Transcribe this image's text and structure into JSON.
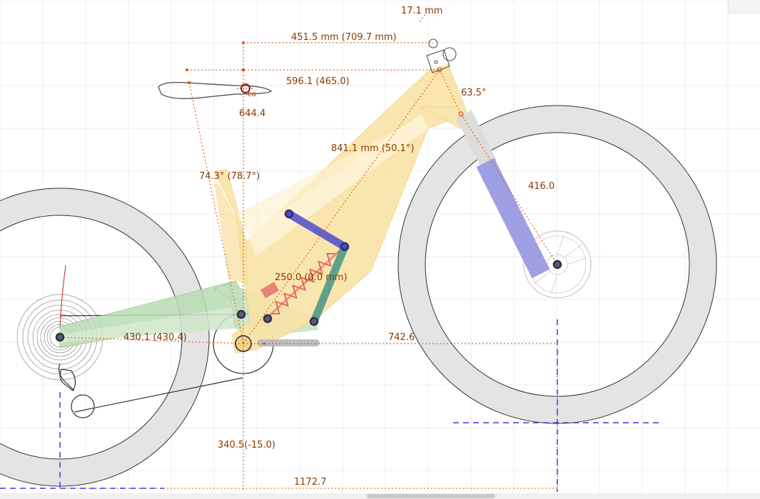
{
  "dimensions": {
    "stem_offset": "17.1 mm",
    "reach_stack": "451.5 mm (709.7 mm)",
    "saddle_to_bar": "596.1 (465.0)",
    "saddle_height": "644.4",
    "head_angle": "63.5°",
    "top_length": "841.1 mm (50.1°)",
    "seat_angle": "74.3° (78.7°)",
    "fork_length": "416.0",
    "shock_length": "250.0 (0.0 mm)",
    "chainstay": "430.1 (430.4)",
    "front_center": "742.6",
    "bb_height": "340.5(-15.0)",
    "wheelbase": "1172.7",
    "cg_label": "CG"
  },
  "colors": {
    "front_triangle": "#f9e3a6",
    "rear_triangle": "#b9dcb5",
    "rocker_link": "#5555cc",
    "seatstay_link": "#4e9a88",
    "fork_lower": "#9a9ae4",
    "fork_upper": "#dcdcdc",
    "shock_spring": "#e06060",
    "tire": "#e4e4e4",
    "dimension_line": "#e04a00",
    "ground_guide": "#3a3ae8"
  },
  "view": {
    "scrollbar_visible": true
  }
}
